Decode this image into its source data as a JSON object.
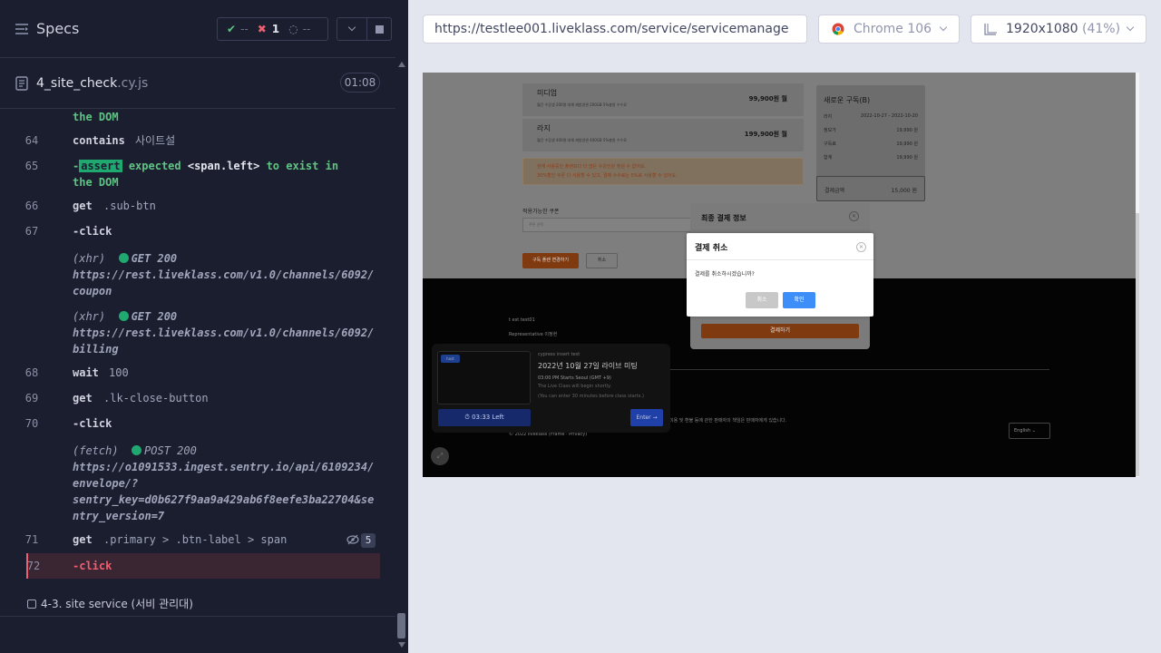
{
  "header": {
    "title": "Specs",
    "passed": "--",
    "failed": "1",
    "pending": "--"
  },
  "file": {
    "name": "4_site_check",
    "ext": ".cy.js",
    "duration": "01:08"
  },
  "commands": {
    "c0_msg": "the DOM",
    "c64_no": "64",
    "c64_name": "contains",
    "c64_msg": "사이트설",
    "c65_no": "65",
    "c65_badge": "assert",
    "c65_expected": "expected",
    "c65_target": "<span.left>",
    "c65_rest": "to exist in",
    "c65_line2": "the DOM",
    "c66_no": "66",
    "c66_name": "get",
    "c66_msg": ".sub-btn",
    "c67_no": "67",
    "c67_name": "-click",
    "x1_type": "(xhr)",
    "x1_method": "GET 200",
    "x1_url1": "https://rest.liveklass.com/v1.0/channels/6092/",
    "x1_url2": "coupon",
    "x2_type": "(xhr)",
    "x2_method": "GET 200",
    "x2_url1": "https://rest.liveklass.com/v1.0/channels/6092/",
    "x2_url2": "billing",
    "c68_no": "68",
    "c68_name": "wait",
    "c68_msg": "100",
    "c69_no": "69",
    "c69_name": "get",
    "c69_msg": ".lk-close-button",
    "c70_no": "70",
    "c70_name": "-click",
    "f1_type": "(fetch)",
    "f1_method": "POST 200",
    "f1_url1": "https://o1091533.ingest.sentry.io/api/6109234/",
    "f1_url2": "envelope/?",
    "f1_url3": "sentry_key=d0b627f9aa9a429ab6f8eefe3ba22704&se",
    "f1_url4": "ntry_version=7",
    "c71_no": "71",
    "c71_name": "get",
    "c71_msg": ".primary > .btn-label > span",
    "c71_count": "5",
    "c72_no": "72",
    "c72_name": "-click"
  },
  "suite": {
    "label": "4-3. site service (서비 관리대)"
  },
  "browser": {
    "url": "https://testlee001.liveklass.com/service/servicemanage",
    "browser_name": "Chrome 106",
    "viewport": "1920x1080",
    "scale": "(41%)"
  },
  "app": {
    "plan1_name": "미디엄",
    "plan1_desc": "월간 수강생 200명 대체   재방영관 200GB   5%충원 수수료",
    "plan1_price": "99,900원 월",
    "plan2_name": "라지",
    "plan2_desc": "월간 수강생 400명 대체   재방영관 400GB   5%충원 수수료",
    "plan2_price": "199,900원 월",
    "warn1": "현재 사용중인 플랜보다 더 많은 수강인원 정원 수 없어요.",
    "warn2": "30%할인 쿠폰 다 사용할 수 있고, 결제 수수료는 5%로 사용할 수 있어요.",
    "side_title": "새로운 구독(B)",
    "side_row1_l": "라지",
    "side_row1_r": "2022-10-27 - 2022-10-20",
    "side_row2_l": "정보가",
    "side_row2_r": "19,990 원",
    "side_row3_l": "구독료",
    "side_row3_r": "19,990 원",
    "side_row4_l": "합계",
    "side_row4_r": "19,990 원",
    "total_l": "결제금액",
    "total_r": "15,000 원",
    "section_label": "적용가능한 쿠폰",
    "section_placeholder": "쿠폰 선택",
    "change_btn": "구독 플랜 변경하기",
    "cancel_small": "취소",
    "final_title": "최종 결제 정보",
    "final_pay": "결제하기",
    "dialog_title": "결제 취소",
    "dialog_msg": "결제를 취소하시겠습니까?",
    "dialog_cancel": "취소",
    "dialog_ok": "확인",
    "footer_email": "t  est  test01",
    "footer_rep": "Representative  이정현",
    "footer_policy": "이용 및 환불 등에 관한 판매자의 책임은 판매자에게 있습니다.",
    "footer_copy": "© 2022 liveklass  (Frame  ·  Privacy)",
    "lang": "English",
    "live_badge": "host",
    "live_host": "cypress insert test",
    "live_title": "2022년 10월 27일 라이브 미팅",
    "live_meta": "03:00 PM Starts Seoul (GMT +9)",
    "live_note1": "The Live Class will begin shortly.",
    "live_note2": "(You can enter 30 minutes before class starts.)",
    "live_left": "03:33 Left",
    "live_enter": "Enter →"
  },
  "colors": {
    "accent_green": "#1fa971",
    "fail_red": "#ef5f6f",
    "ok_blue": "#3d8ef8"
  }
}
